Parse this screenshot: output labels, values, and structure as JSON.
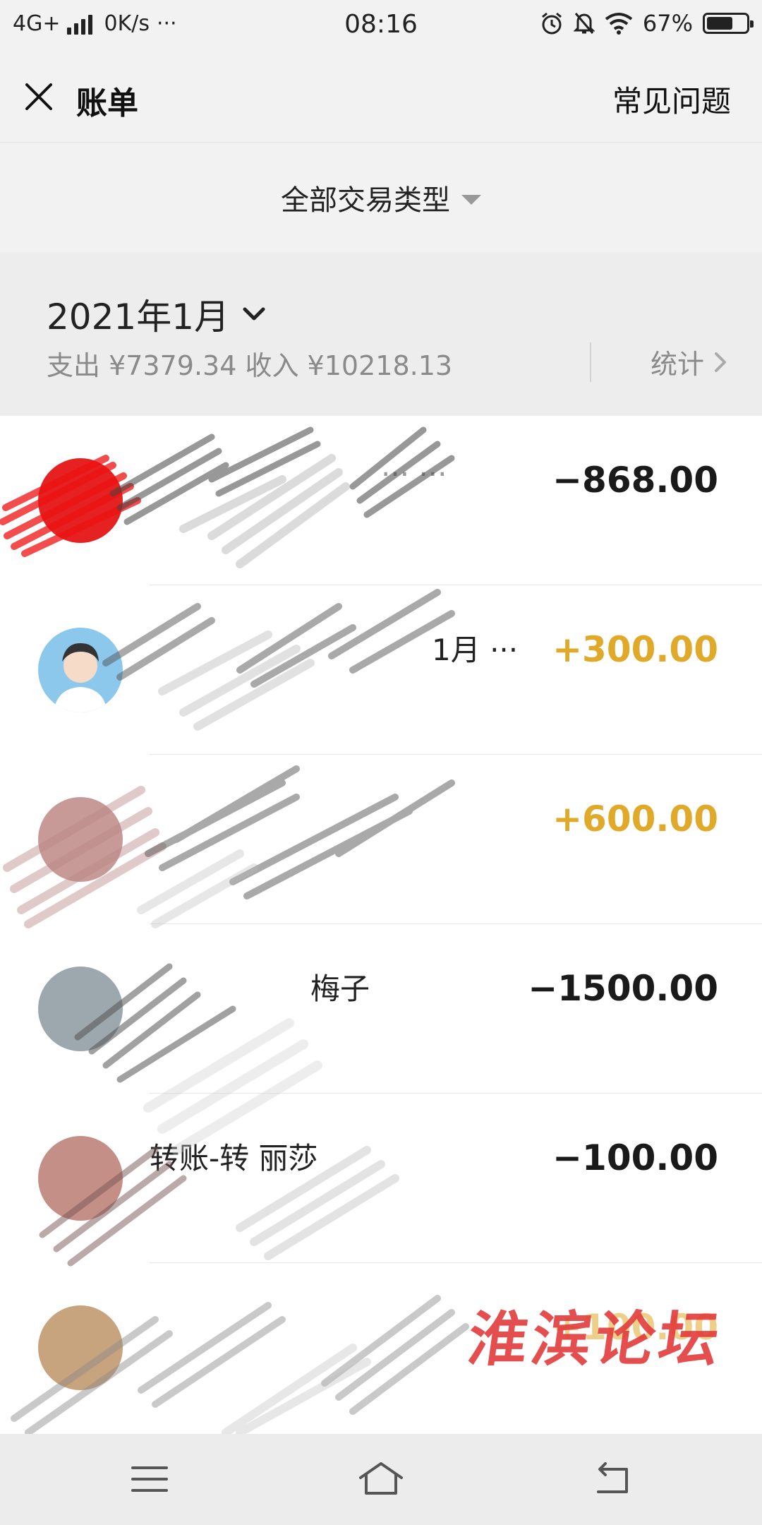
{
  "status_bar": {
    "network": "4G+",
    "speed": "0K/s",
    "more": "···",
    "time": "08:16",
    "battery": "67%",
    "battery_level": 0.67
  },
  "nav": {
    "title": "账单",
    "faq": "常见问题"
  },
  "filter": {
    "label": "全部交易类型"
  },
  "month": {
    "label": "2021年1月",
    "summary": "支出 ¥7379.34 收入 ¥10218.13",
    "stats_label": "统计"
  },
  "transactions": [
    {
      "title": "··· ···",
      "date": "",
      "amount": "−868.00",
      "type": "expense"
    },
    {
      "title": "1月 ···",
      "date": "",
      "amount": "+300.00",
      "type": "income"
    },
    {
      "title": "",
      "date": "",
      "amount": "+600.00",
      "type": "income"
    },
    {
      "title": "梅子",
      "date": "",
      "amount": "−1500.00",
      "type": "expense"
    },
    {
      "title": "转账-转 丽莎",
      "date": "",
      "amount": "−100.00",
      "type": "expense"
    },
    {
      "title": "",
      "date": "",
      "amount": "+100.00",
      "type": "income"
    }
  ],
  "watermark": "淮滨论坛",
  "colors": {
    "income": "#e0a92a",
    "expense": "#1a1a1a",
    "background": "#f2f2f2",
    "watermark": "#e23b3b"
  },
  "icons": {
    "close": "close-icon",
    "filter_caret": "caret-down-icon",
    "month_chevron": "chevron-down-icon",
    "stats_chevron": "chevron-right-icon",
    "nav_menu": "menu-icon",
    "nav_home": "home-icon",
    "nav_back": "back-icon"
  }
}
